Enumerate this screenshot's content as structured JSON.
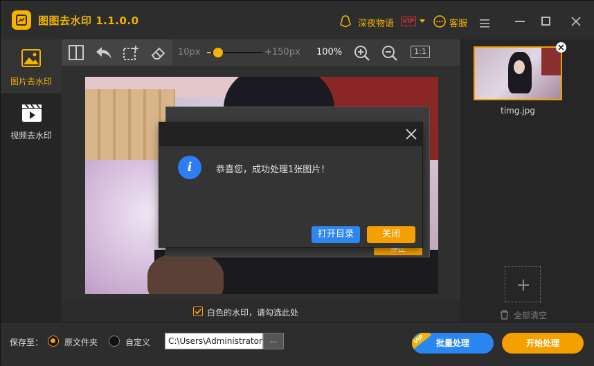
{
  "app": {
    "title": "图图去水印  1.1.0.0"
  },
  "header": {
    "user_name": "深夜物语",
    "vip": "VIP",
    "service": "客服"
  },
  "sidebar": {
    "items": [
      {
        "label": "图片去水印",
        "active": true
      },
      {
        "label": "视频去水印",
        "active": false
      }
    ]
  },
  "toolbar": {
    "brush_min": "10px",
    "brush_max": "+150px",
    "brush_level": 0.07,
    "zoom": "100%",
    "actual_size": "1:1"
  },
  "bg_dialog": {
    "stop_label": "停止"
  },
  "modal": {
    "message": "恭喜您，成功处理1张图片！",
    "open_dir": "打开目录",
    "close": "关闭"
  },
  "canvas": {
    "white_watermark_label": "白色的水印，请勾选此处",
    "white_watermark_checked": true
  },
  "filelist": {
    "items": [
      {
        "name": "timg.jpg"
      }
    ],
    "clear_all": "全部清空"
  },
  "footer": {
    "save_to": "保存至：",
    "opt_original": "原文件夹",
    "opt_custom": "自定义",
    "path": "C:\\Users\\Administrator",
    "browse": "...",
    "batch": "批量处理",
    "batch_vip": "VIP",
    "start": "开始处理"
  },
  "colors": {
    "accent": "#f5a000",
    "brand_yellow": "#f5b400",
    "blue": "#2e86f0"
  }
}
